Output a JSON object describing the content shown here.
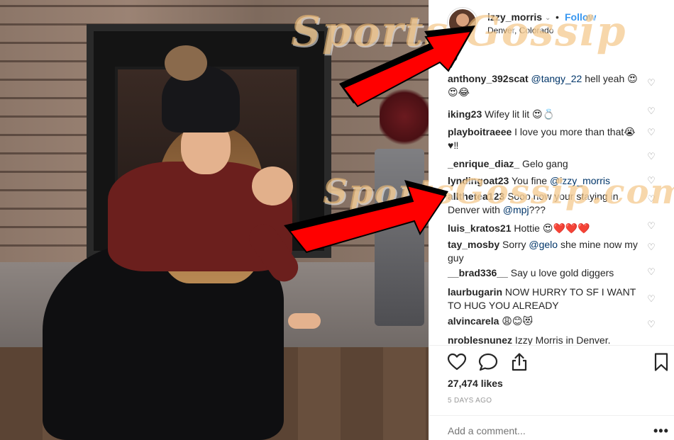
{
  "post": {
    "username": "izzy_morris",
    "location": "Denver, Colorado",
    "follow_label": "Follow",
    "dot": "•",
    "verified_glyph": "⌄"
  },
  "comments": [
    {
      "user": "anthony_392scat",
      "parts": [
        {
          "t": "mention",
          "v": "@tangy_22"
        },
        {
          "t": "text",
          "v": " hell yeah 😍😍😂"
        }
      ]
    },
    {
      "user": "iking23",
      "parts": [
        {
          "t": "text",
          "v": "Wifey lit lit 😍💍"
        }
      ]
    },
    {
      "user": "playboitraeee",
      "parts": [
        {
          "t": "text",
          "v": "I love you more than that😭♥‼"
        }
      ]
    },
    {
      "user": "_enrique_diaz_",
      "parts": [
        {
          "t": "text",
          "v": "Gelo gang"
        }
      ]
    },
    {
      "user": "lyndingoat23",
      "parts": [
        {
          "t": "text",
          "v": "You fine "
        },
        {
          "t": "mention",
          "v": "@izzy_morris"
        }
      ]
    },
    {
      "user": "allthetea123",
      "parts": [
        {
          "t": "text",
          "v": "Sooo now your staying in Denver with "
        },
        {
          "t": "mention",
          "v": "@mpj"
        },
        {
          "t": "text",
          "v": "???"
        }
      ]
    },
    {
      "user": "luis_kratos21",
      "parts": [
        {
          "t": "text",
          "v": "Hottie 😍❤️❤️❤️"
        }
      ]
    },
    {
      "user": "tay_mosby",
      "parts": [
        {
          "t": "text",
          "v": "Sorry "
        },
        {
          "t": "mention",
          "v": "@gelo"
        },
        {
          "t": "text",
          "v": " she mine now my guy"
        }
      ]
    },
    {
      "user": "__brad336__",
      "parts": [
        {
          "t": "text",
          "v": "Say u love gold diggers"
        }
      ]
    },
    {
      "user": "laurbugarin",
      "parts": [
        {
          "t": "text",
          "v": "NOW HURRY TO SF I WANT TO HUG YOU ALREADY"
        }
      ]
    },
    {
      "user": "alvincarela",
      "parts": [
        {
          "t": "text",
          "v": "😩😊😻"
        }
      ]
    },
    {
      "user": "nroblesnunez",
      "parts": [
        {
          "t": "text",
          "v": "Izzy Morris in Denver."
        }
      ]
    }
  ],
  "partial_top_comment": "😁",
  "actions": {
    "like_icon": "heart-outline",
    "comment_icon": "speech-bubble",
    "share_icon": "share-upload",
    "save_icon": "bookmark"
  },
  "likes": "27,474 likes",
  "time_ago": "5 DAYS AGO",
  "add_comment_placeholder": "Add a comment...",
  "more_label": "•••",
  "watermark": {
    "text1": "Sports Gossip",
    "text2": "SportsGossip.com",
    "color": "#f2be78"
  },
  "overlay_arrow_color": "#ff0000",
  "link_color": "#003569",
  "follow_color": "#3897f0"
}
